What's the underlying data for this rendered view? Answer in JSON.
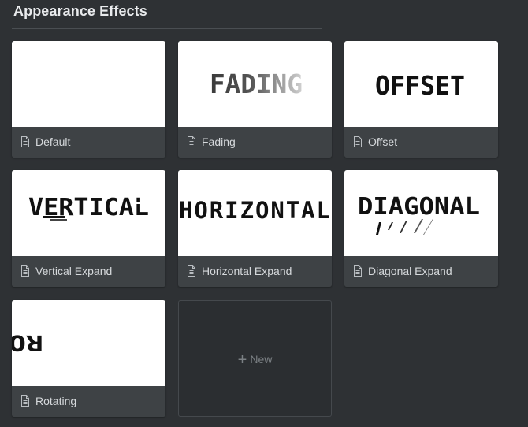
{
  "header": {
    "title": "Appearance Effects"
  },
  "cards": [
    {
      "label": "Default",
      "icon": "document-icon"
    },
    {
      "label": "Fading",
      "icon": "document-icon",
      "preview_text": "FADING"
    },
    {
      "label": "Offset",
      "icon": "document-icon",
      "preview_text": "OFFSET"
    },
    {
      "label": "Vertical Expand",
      "icon": "document-icon",
      "preview_text": "VERTICAL"
    },
    {
      "label": "Horizontal Expand",
      "icon": "document-icon",
      "preview_text": "HORIZONTAL"
    },
    {
      "label": "Diagonal Expand",
      "icon": "document-icon",
      "preview_text": "DIAGONAL"
    },
    {
      "label": "Rotating",
      "icon": "document-icon",
      "preview_text": "RO"
    }
  ],
  "new_card": {
    "plus": "+",
    "label": "New"
  },
  "colors": {
    "background": "#2e3134",
    "card_bar": "#3e4245",
    "text": "#d6d9dc",
    "title": "#e9ebed"
  }
}
